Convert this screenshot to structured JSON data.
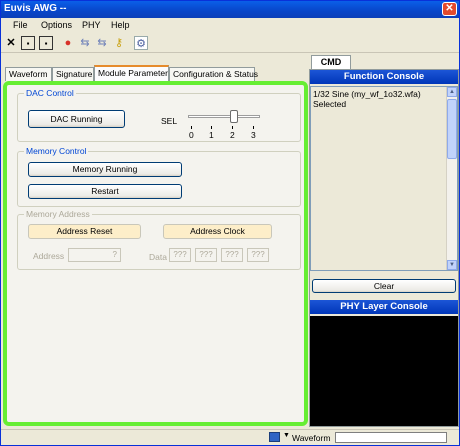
{
  "window": {
    "title": "Euvis AWG --",
    "close_glyph": "✕"
  },
  "menu": {
    "file": "File",
    "options": "Options",
    "phy": "PHY",
    "help": "Help"
  },
  "toolbar": {
    "icons": [
      "close-x-icon",
      "save-icon",
      "save-all-icon",
      "stop-icon",
      "connect-icon",
      "disconnect-icon",
      "key-icon",
      "settings-icon"
    ],
    "glyphs": {
      "x": "✕",
      "save": "▪",
      "saveall": "▪",
      "stop": "●",
      "connect": "⇆",
      "disconnect": "⇆",
      "key": "⚷",
      "settings": "⚙"
    }
  },
  "tabs": {
    "waveform": "Waveform",
    "signature": "Signature",
    "module": "Module Parameter",
    "config": "Configuration & Status"
  },
  "dac_control": {
    "title": "DAC Control",
    "button": "DAC Running",
    "sel_label": "SEL",
    "ticks": [
      "0",
      "1",
      "2",
      "3"
    ],
    "sel_value": 2
  },
  "memory_control": {
    "title": "Memory Control",
    "running": "Memory Running",
    "restart": "Restart"
  },
  "memory_address": {
    "title": "Memory Address",
    "reset": "Address Reset",
    "clock": "Address Clock",
    "address_label": "Address",
    "address_value": "?",
    "data_label": "Data",
    "data_values": [
      "???",
      "???",
      "???",
      "???"
    ]
  },
  "right": {
    "cmd_tab": "CMD",
    "function_console": "Function Console",
    "console_lines": [
      "1/32 Sine (my_wf_1o32.wfa)",
      "Selected"
    ],
    "clear": "Clear",
    "phy_console": "PHY Layer Console"
  },
  "status": {
    "waveform": "Waveform"
  },
  "colors": {
    "highlight_border": "#66ee33",
    "console_header": "#0036b9",
    "phy_body": "#000000"
  }
}
